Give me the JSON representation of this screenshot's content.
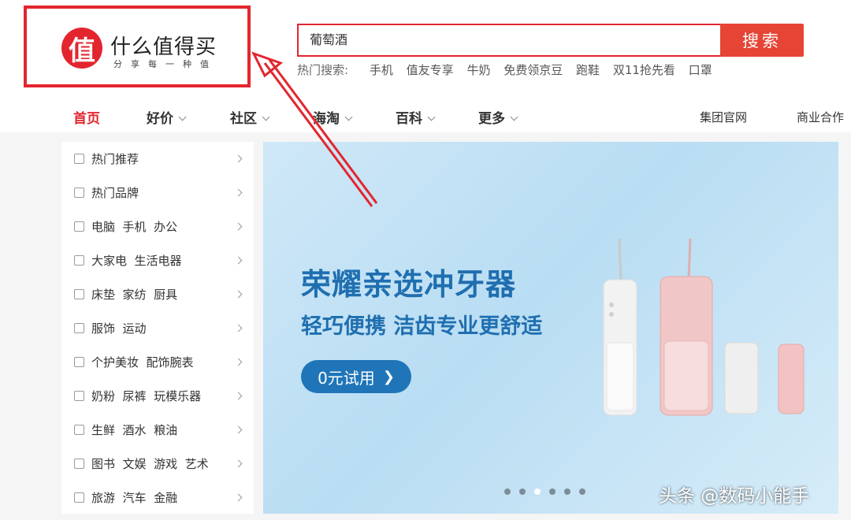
{
  "logo": {
    "mark": "值",
    "title": "什么值得买",
    "slogan": "分享每一种值"
  },
  "search": {
    "value": "葡萄酒",
    "button_label": "搜索"
  },
  "hot": {
    "label": "热门搜索:",
    "terms": [
      "手机",
      "值友专享",
      "牛奶",
      "免费领京豆",
      "跑鞋",
      "双11抢先看",
      "口罩"
    ]
  },
  "nav": {
    "items": [
      {
        "label": "首页",
        "active": true
      },
      {
        "label": "好价"
      },
      {
        "label": "社区"
      },
      {
        "label": "海淘"
      },
      {
        "label": "百科"
      },
      {
        "label": "更多"
      }
    ],
    "right": [
      "集团官网",
      "商业合作"
    ]
  },
  "sidebar": {
    "items": [
      {
        "label": "热门推荐"
      },
      {
        "label": "热门品牌"
      },
      {
        "label": "电脑  手机  办公"
      },
      {
        "label": "大家电  生活电器"
      },
      {
        "label": "床垫  家纺  厨具"
      },
      {
        "label": "服饰  运动"
      },
      {
        "label": "个护美妆  配饰腕表"
      },
      {
        "label": "奶粉  尿裤  玩模乐器"
      },
      {
        "label": "生鲜  酒水  粮油"
      },
      {
        "label": "图书  文娱  游戏  艺术"
      },
      {
        "label": "旅游  汽车  金融"
      }
    ]
  },
  "banner": {
    "title": "荣耀亲选冲牙器",
    "subtitle": "轻巧便携 洁齿专业更舒适",
    "cta": "0元试用",
    "slide_count": 6,
    "active_slide": 3
  },
  "watermark": "头条 @数码小能手",
  "colors": {
    "brand_red": "#e3262e",
    "banner_blue": "#1f6fb0"
  }
}
